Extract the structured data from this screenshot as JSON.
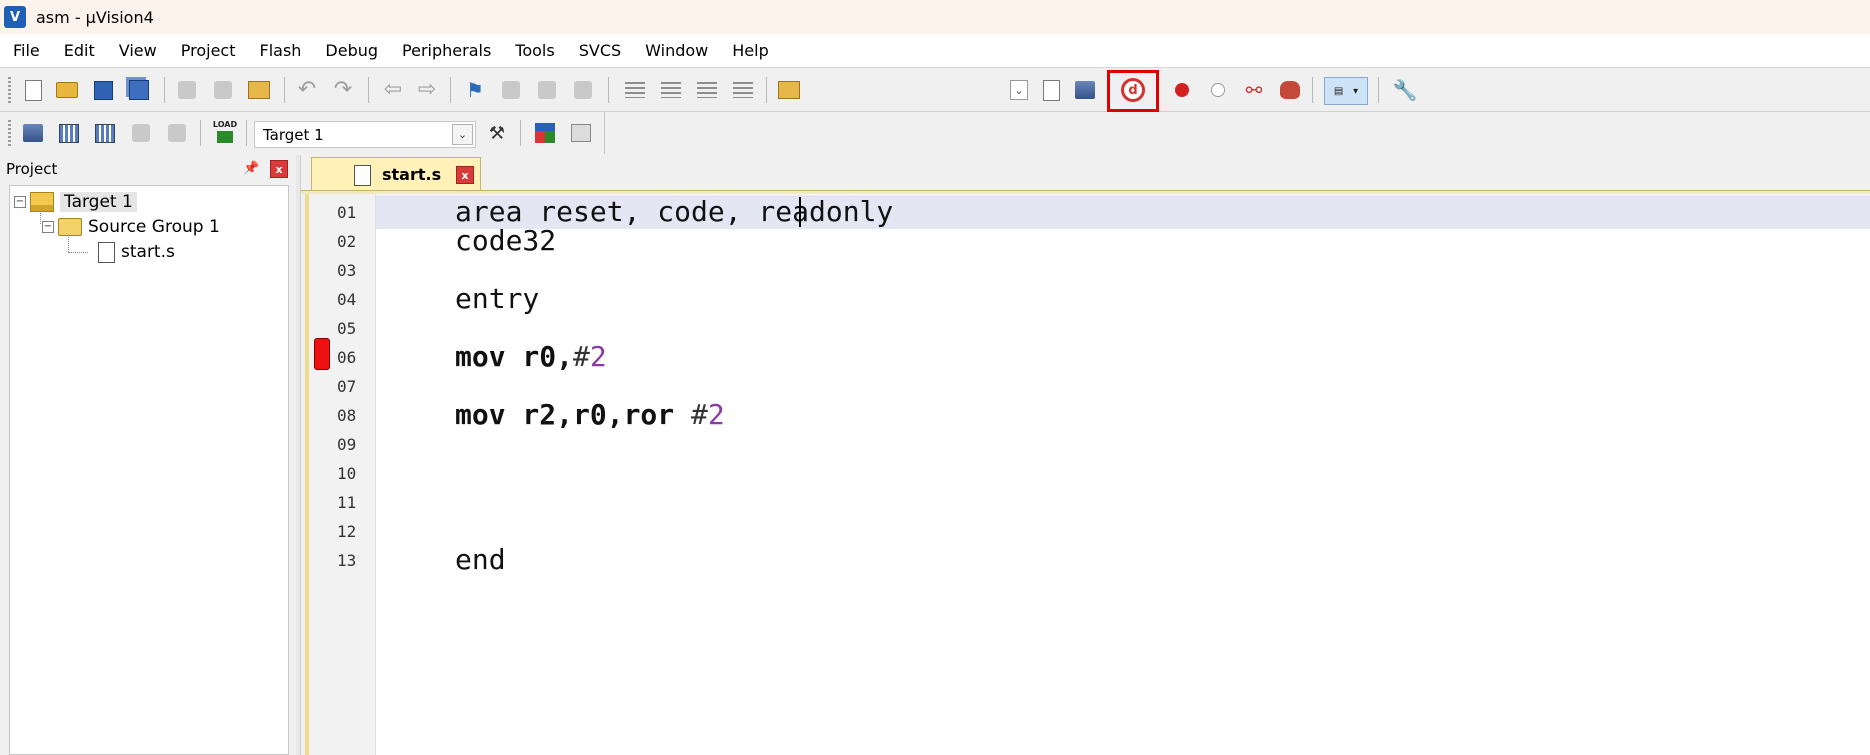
{
  "window": {
    "title": "asm  - µVision4",
    "app_icon_letter": "V"
  },
  "menu": [
    "File",
    "Edit",
    "View",
    "Project",
    "Flash",
    "Debug",
    "Peripherals",
    "Tools",
    "SVCS",
    "Window",
    "Help"
  ],
  "toolbar2": {
    "target_select": "Target 1",
    "load_label": "LOAD"
  },
  "project_panel": {
    "title": "Project",
    "tree": {
      "target": "Target 1",
      "group": "Source Group 1",
      "file": "start.s"
    }
  },
  "editor": {
    "tab_label": "start.s",
    "lines": [
      {
        "no": "01",
        "text": "area reset, code, readonly"
      },
      {
        "no": "02",
        "text": "code32"
      },
      {
        "no": "03",
        "text": ""
      },
      {
        "no": "04",
        "text": "entry"
      },
      {
        "no": "05",
        "text": ""
      },
      {
        "no": "06",
        "kw": "mov r0,",
        "hash": "#",
        "num": "2"
      },
      {
        "no": "07",
        "text": ""
      },
      {
        "no": "08",
        "kw": "mov r2,r0,ror ",
        "hash": "#",
        "num": "2"
      },
      {
        "no": "09",
        "text": ""
      },
      {
        "no": "10",
        "text": ""
      },
      {
        "no": "11",
        "text": ""
      },
      {
        "no": "12",
        "text": ""
      },
      {
        "no": "13",
        "text": "end"
      }
    ]
  },
  "colors": {
    "breakpoint": "#ee1111",
    "highlight_box": "#e00000",
    "number_literal": "#8a3aa5",
    "tab_bg": "#fff1b8"
  }
}
